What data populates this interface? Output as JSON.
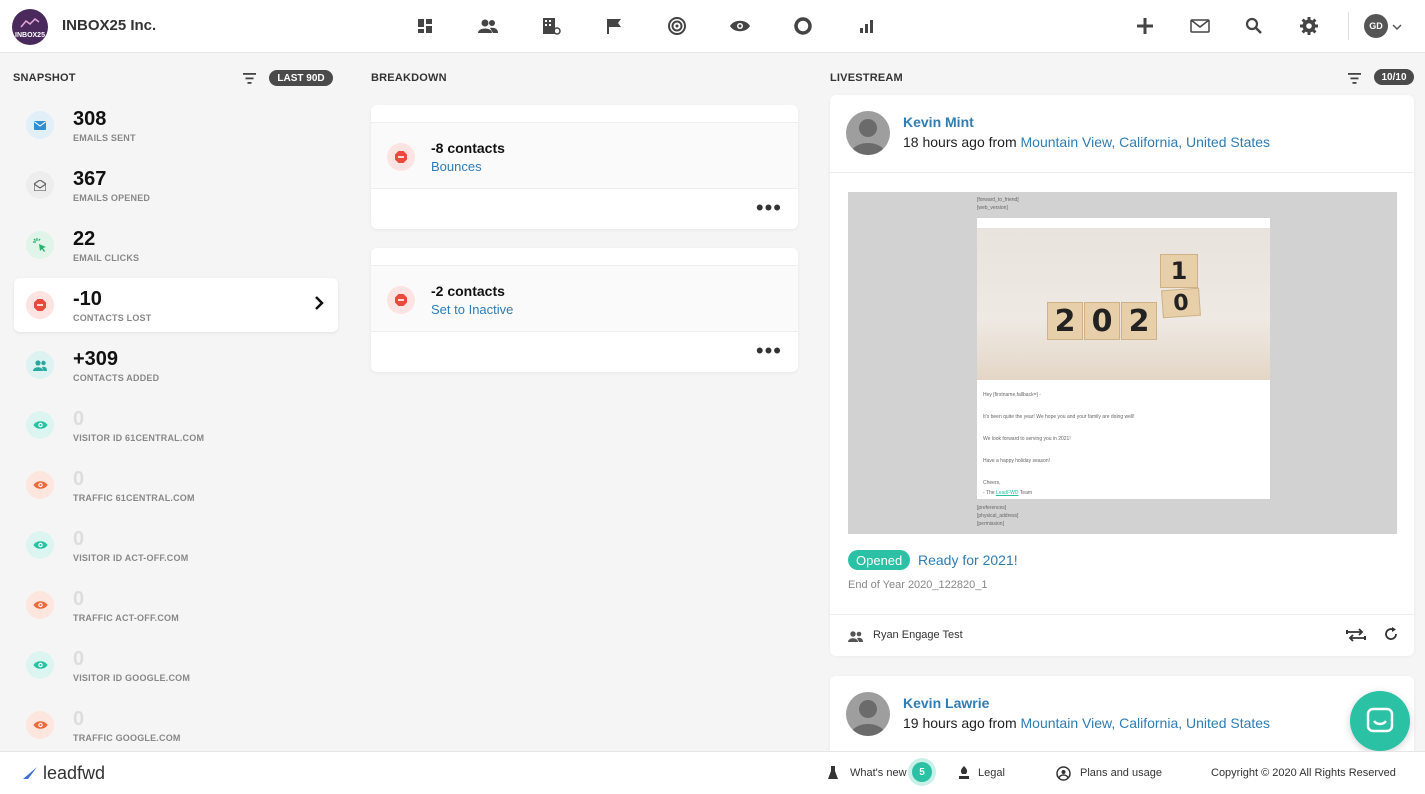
{
  "org": {
    "logo_text": "INBOX25",
    "name": "INBOX25 Inc."
  },
  "topnav": {
    "icons": [
      "dashboard-icon",
      "contacts-icon",
      "companies-icon",
      "flag-icon",
      "target-icon",
      "eye-icon",
      "circle-icon",
      "bar-chart-icon"
    ],
    "right_icons": [
      "plus-icon",
      "mail-icon",
      "search-icon",
      "gear-icon"
    ],
    "user_initials": "GD"
  },
  "snapshot": {
    "header": "SNAPSHOT",
    "range": "LAST 90D",
    "items": [
      {
        "value": "308",
        "label": "EMAILS SENT",
        "icon": "envelope-icon",
        "color": "#2f8fd0",
        "bg": "#e1eff9"
      },
      {
        "value": "367",
        "label": "EMAILS OPENED",
        "icon": "open-envelope-icon",
        "color": "#666",
        "bg": "#ededed"
      },
      {
        "value": "22",
        "label": "EMAIL CLICKS",
        "icon": "cursor-click-icon",
        "color": "#28b26b",
        "bg": "#e0f4e9"
      },
      {
        "value": "-10",
        "label": "CONTACTS LOST",
        "icon": "stop-icon",
        "color": "#ea4a3c",
        "bg": "#fde3e1"
      },
      {
        "value": "+309",
        "label": "CONTACTS ADDED",
        "icon": "users-icon",
        "color": "#2aa7a0",
        "bg": "#dcf3f1"
      },
      {
        "value": "0",
        "label": "VISITOR ID 61CENTRAL.COM",
        "icon": "eye-icon",
        "color": "#2bc1a5",
        "bg": "#dcf5f0"
      },
      {
        "value": "0",
        "label": "TRAFFIC 61CENTRAL.COM",
        "icon": "eye-icon",
        "color": "#ee6a3d",
        "bg": "#fde6dd"
      },
      {
        "value": "0",
        "label": "VISITOR ID ACT-OFF.COM",
        "icon": "eye-icon",
        "color": "#2bc1a5",
        "bg": "#dcf5f0"
      },
      {
        "value": "0",
        "label": "TRAFFIC ACT-OFF.COM",
        "icon": "eye-icon",
        "color": "#ee6a3d",
        "bg": "#fde6dd"
      },
      {
        "value": "0",
        "label": "VISITOR ID GOOGLE.COM",
        "icon": "eye-icon",
        "color": "#2bc1a5",
        "bg": "#dcf5f0"
      },
      {
        "value": "0",
        "label": "TRAFFIC GOOGLE.COM",
        "icon": "eye-icon",
        "color": "#ee6a3d",
        "bg": "#fde6dd"
      }
    ]
  },
  "breakdown": {
    "header": "BREAKDOWN",
    "cards": [
      {
        "title": "-8 contacts",
        "link": "Bounces"
      },
      {
        "title": "-2 contacts",
        "link": "Set to Inactive"
      }
    ]
  },
  "livestream": {
    "header": "LIVESTREAM",
    "count": "10/10",
    "entries": [
      {
        "name": "Kevin Mint",
        "time": "18 hours ago from",
        "location": "Mountain View, California, United States",
        "email_preview": {
          "top_lines": [
            "[forward_to_friend]",
            "[web_version]"
          ],
          "year_blocks": [
            "2",
            "0",
            "2",
            "0",
            "1"
          ],
          "body": [
            "Hey [firstname,fallback=] -",
            "It's been quite the year! We hope you and your family are doing well!",
            "We look forward to serving you in 2021!",
            "Have a happy holiday season!",
            "Cheers,"
          ],
          "sign_pre": "- The ",
          "sign_link": "LeadFWD",
          "sign_post": " Team",
          "bottom_lines": [
            "[preferences]",
            "[physical_address]",
            "[permission]"
          ]
        },
        "status": "Opened",
        "subject": "Ready for 2021!",
        "campaign": "End of Year 2020_122820_1",
        "group": "Ryan Engage Test"
      },
      {
        "name": "Kevin Lawrie",
        "time": "19 hours ago from",
        "location": "Mountain View, California, United States"
      }
    ]
  },
  "footer": {
    "brand": "leadfwd",
    "whats_new": "What's new",
    "whats_new_badge": "5",
    "legal": "Legal",
    "plans": "Plans and usage",
    "copyright": "Copyright © 2020 All Rights Reserved"
  }
}
